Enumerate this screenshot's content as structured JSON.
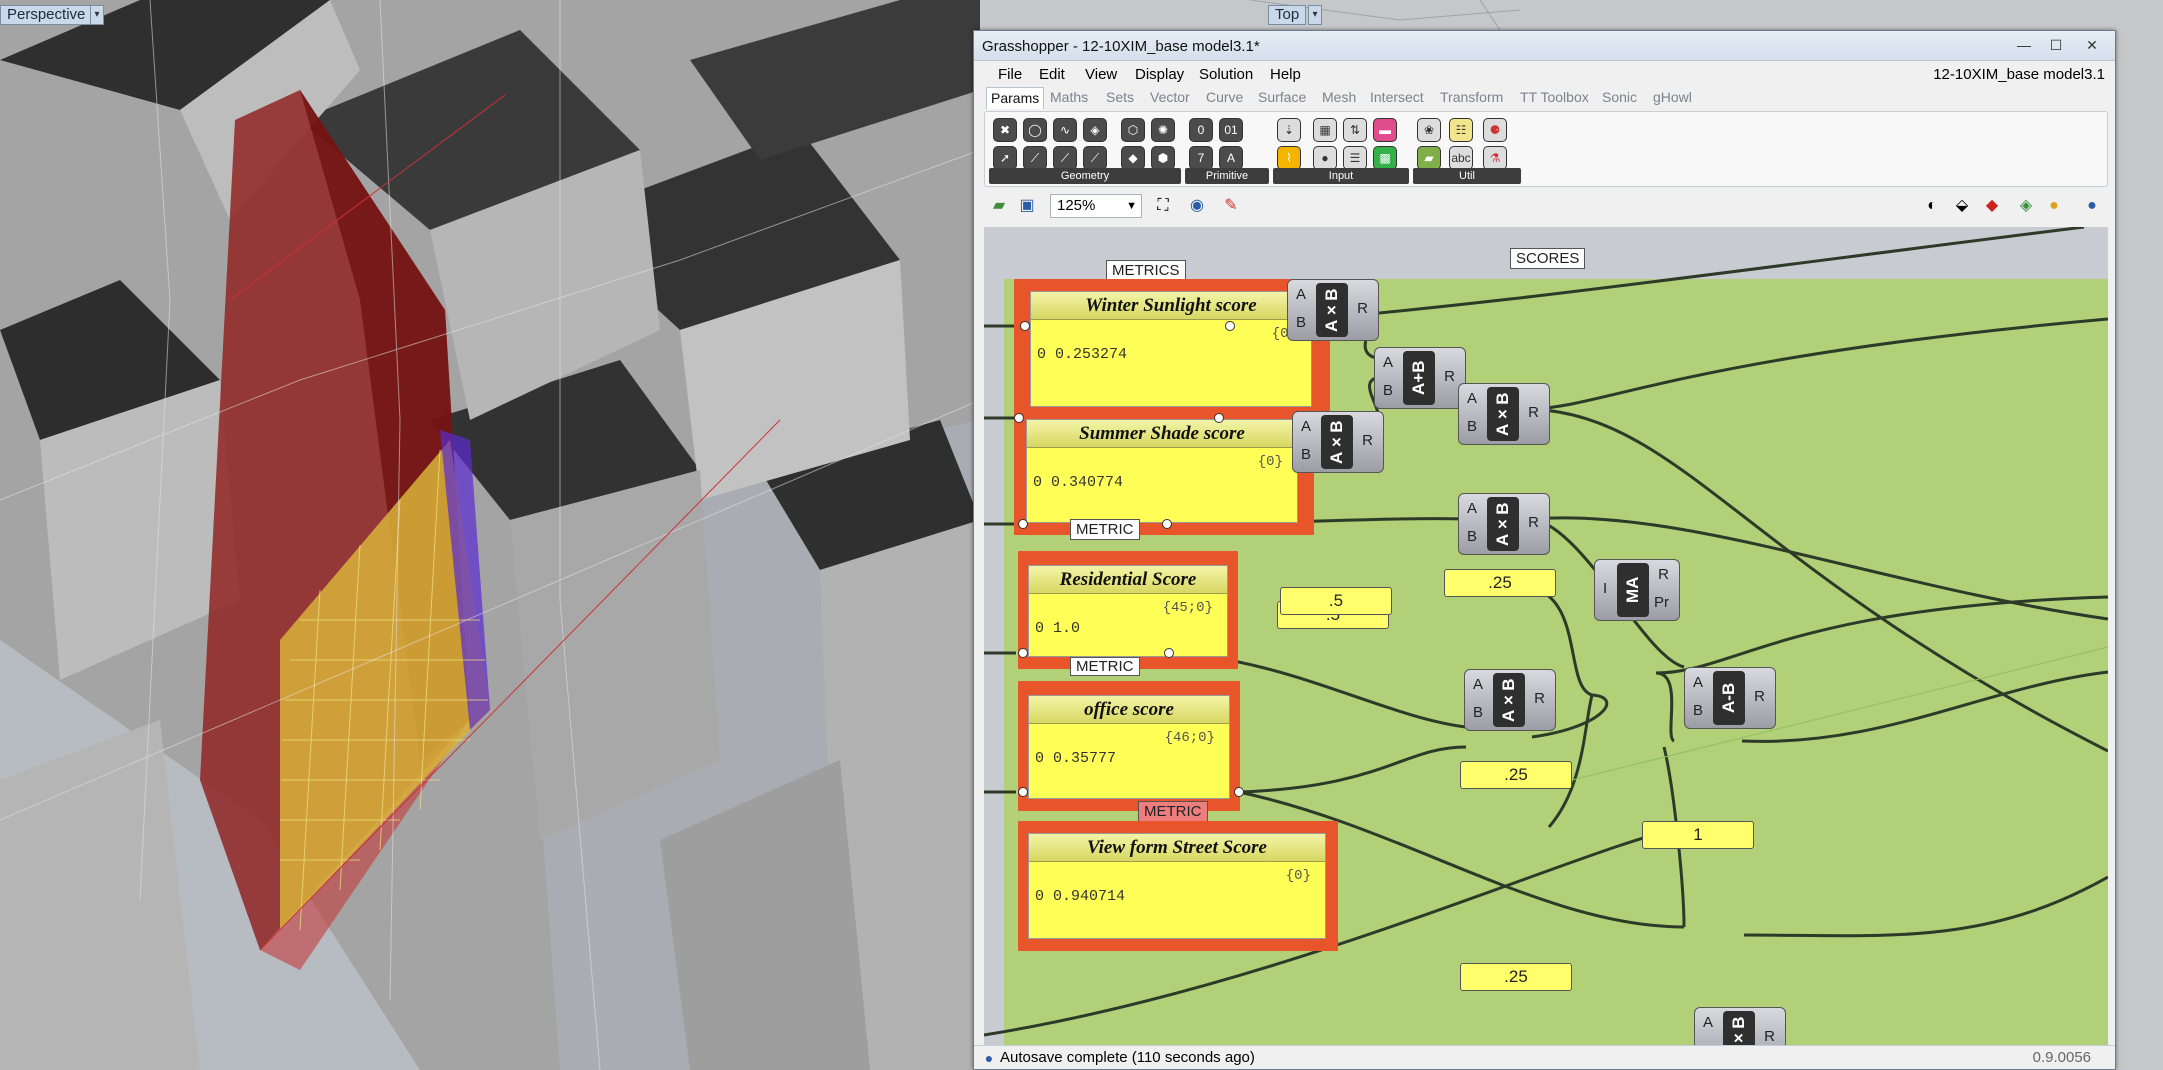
{
  "viewport": {
    "perspective_label": "Perspective",
    "top_label": "Top"
  },
  "gh": {
    "title": "Grasshopper - 12-10XIM_base model3.1*",
    "doc_name": "12-10XIM_base model3.1",
    "menu": [
      "File",
      "Edit",
      "View",
      "Display",
      "Solution",
      "Help"
    ],
    "tabs": [
      "Params",
      "Maths",
      "Sets",
      "Vector",
      "Curve",
      "Surface",
      "Mesh",
      "Intersect",
      "Transform",
      "TT Toolbox",
      "Sonic",
      "gHowl"
    ],
    "ribbon_groups": [
      "Geometry",
      "Primitive",
      "Input",
      "Util"
    ],
    "zoom": "125%",
    "status": "Autosave complete (110 seconds ago)",
    "version": "0.9.0056"
  },
  "canvas": {
    "callouts": {
      "metrics": "METRICS",
      "scores": "SCORES",
      "metric1": "METRIC",
      "metric2": "METRIC",
      "metric3": "METRIC"
    },
    "panels": [
      {
        "title": "Winter Sunlight score",
        "path": "{0}",
        "index": "0",
        "value": "0.253274"
      },
      {
        "title": "Summer Shade score",
        "path": "{0}",
        "index": "0",
        "value": "0.340774"
      },
      {
        "title": "Residential Score",
        "path": "{45;0}",
        "index": "0",
        "value": "1.0"
      },
      {
        "title": "office score",
        "path": "{46;0}",
        "index": "0",
        "value": "0.35777"
      },
      {
        "title": "View form Street Score",
        "path": "{0}",
        "index": "0",
        "value": "0.940714"
      }
    ],
    "components": [
      {
        "label": "A×B",
        "a": "A",
        "b": "B",
        "r": "R"
      },
      {
        "label": "A×B",
        "a": "A",
        "b": "B",
        "r": "R"
      },
      {
        "label": "A+B",
        "a": "A",
        "b": "B",
        "r": "R"
      },
      {
        "label": "A×B",
        "a": "A",
        "b": "B",
        "r": "R"
      },
      {
        "label": "A×B",
        "a": "A",
        "b": "B",
        "r": "R"
      },
      {
        "label": "MA",
        "a": "I",
        "b": "",
        "r": "R",
        "r2": "Pr"
      },
      {
        "label": "A-B",
        "a": "A",
        "b": "B",
        "r": "R"
      },
      {
        "label": "A×B",
        "a": "A",
        "b": "B",
        "r": "R"
      },
      {
        "label": "A×B",
        "a": "A",
        "b": "B",
        "r": "R"
      }
    ],
    "sliders": [
      ".5",
      ".5",
      ".25",
      ".25",
      "1",
      ".25"
    ]
  }
}
